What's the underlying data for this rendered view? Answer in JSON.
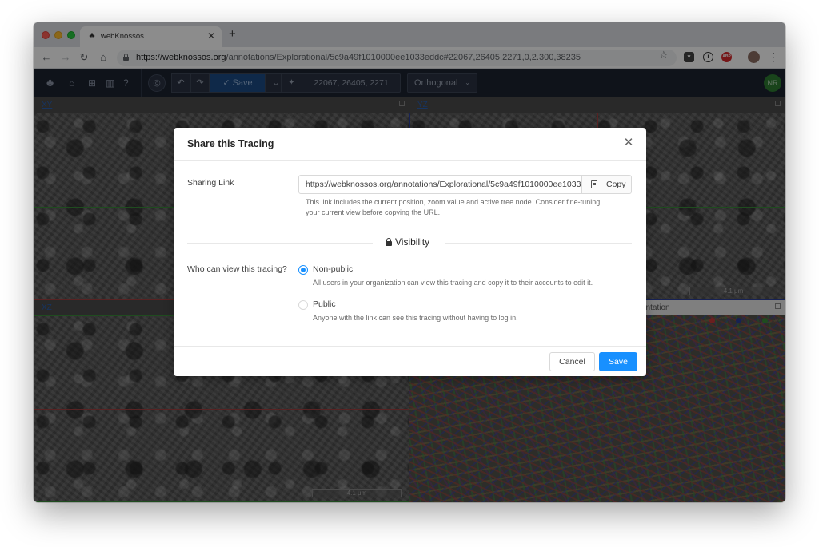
{
  "browser": {
    "tab_title": "webKnossos",
    "url_domain": "https://webknossos.org",
    "url_path": "/annotations/Explorational/5c9a49f1010000ee1033eddc#22067,26405,2271,0,2.300,38235"
  },
  "appbar": {
    "save_label": "Save",
    "position": "22067, 26405, 2271",
    "view_mode": "Orthogonal",
    "user_initials": "NR"
  },
  "viewports": {
    "xy_label": "XY",
    "yz_label": "YZ",
    "xz_label": "XZ",
    "td_label": "entation",
    "td_buttons": [
      "3D",
      "XY",
      "YZ",
      "XZ"
    ],
    "scale_label": "4.1 μm"
  },
  "colors": {
    "accent": "#1890ff",
    "xy": "#a04040",
    "yz": "#2a3f9a",
    "xz": "#3a8a3a"
  },
  "modal": {
    "title": "Share this Tracing",
    "sharing_link_label": "Sharing Link",
    "sharing_link_value": "https://webknossos.org/annotations/Explorational/5c9a49f1010000ee1033eddc#22067,26405,2271,0,2.300,38235",
    "copy_label": "Copy",
    "help_line1": "This link includes the current position, zoom value and active tree node. Consider fine-tuning",
    "help_line2": "your current view before copying the URL.",
    "visibility_title": "Visibility",
    "who_can_view_label": "Who can view this tracing?",
    "options": [
      {
        "label": "Non-public",
        "description": "All users in your organization can view this tracing and copy it to their accounts to edit it.",
        "selected": true
      },
      {
        "label": "Public",
        "description": "Anyone with the link can see this tracing without having to log in.",
        "selected": false
      }
    ],
    "cancel_label": "Cancel",
    "save_label": "Save"
  }
}
